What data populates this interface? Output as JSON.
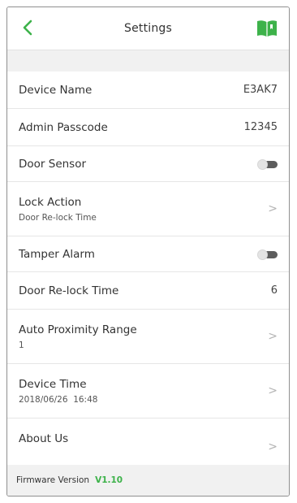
{
  "header": {
    "title": "Settings"
  },
  "colors": {
    "accent": "#3db24a",
    "chevron": "#b3b3b3",
    "toggle_off": "#5d5d5d"
  },
  "icons": {
    "back": "chevron-left-icon",
    "guide": "book-icon"
  },
  "settings": [
    {
      "label": "Device Name",
      "value": "E3AK7"
    },
    {
      "label": "Admin Passcode",
      "value": "12345"
    },
    {
      "label": "Door Sensor",
      "toggle": false
    },
    {
      "label": "Lock Action",
      "sub": "Door Re-lock Time"
    },
    {
      "label": "Tamper Alarm",
      "toggle": false
    },
    {
      "label": "Door Re-lock Time",
      "value": "6"
    },
    {
      "label": "Auto Proximity Range",
      "sub": "1"
    },
    {
      "label": "Device Time",
      "sub": "2018/06/26  16:48"
    },
    {
      "label": "About Us"
    }
  ],
  "footer": {
    "label": "Firmware Version",
    "version": "V1.10"
  }
}
